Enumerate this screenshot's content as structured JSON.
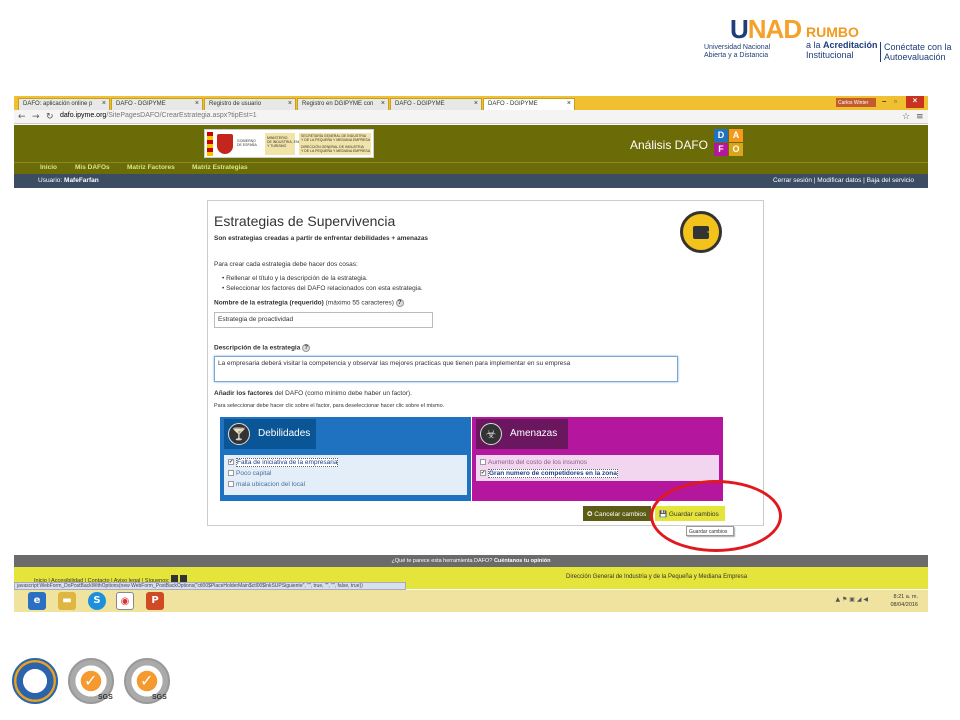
{
  "branding": {
    "unad_word": "NAD",
    "unad_u": "U",
    "unad_sub_1": "Universidad Nacional",
    "unad_sub_2": "Abierta y a Distancia",
    "rumbo": "RUMBO",
    "rumbo_sub_1": "a la ",
    "rumbo_sub_bold": "Acreditación",
    "rumbo_sub_2": "Institucional",
    "conectate_1": "Conéctate con la",
    "conectate_2": "Autoevaluación"
  },
  "browser": {
    "tabs": [
      {
        "label": "DAFO: aplicación online p"
      },
      {
        "label": "DAFO - DGIPYME"
      },
      {
        "label": "Registro de usuario"
      },
      {
        "label": "Registro en DGIPYME con"
      },
      {
        "label": "DAFO - DGIPYME"
      },
      {
        "label": "DAFO - DGIPYME"
      }
    ],
    "user_badge": "Carlos Winter",
    "url_host": "dafo.ipyme.org",
    "url_path": "/SitePagesDAFO/CrearEstrategia.aspx?tipEst=1"
  },
  "site": {
    "gov_line1": "GOBIERNO",
    "gov_line2": "DE ESPAÑA",
    "ministry_1": "MINISTERIO",
    "ministry_2": "DE INDUSTRIA, ENERGÍA",
    "ministry_3": "Y TURISMO",
    "secretaria_1": "SECRETARÍA GENERAL DE INDUSTRIA",
    "secretaria_2": "Y DE LA PEQUEÑA Y MEDIANA EMPRESA",
    "direccion_1": "DIRECCIÓN GENERAL DE INDUSTRIA",
    "direccion_2": "Y DE LA PEQUEÑA Y MEDIANA EMPRESA",
    "title": "Análisis DAFO",
    "dafo_letters": [
      "D",
      "A",
      "F",
      "O"
    ],
    "dafo_colors": [
      "#1f72c0",
      "#f39a1e",
      "#b5169e",
      "#d9a51a"
    ],
    "menu": [
      "Inicio",
      "Mis DAFOs",
      "Matriz Factores",
      "Matriz Estrategias"
    ],
    "user_label": "Usuario:",
    "user_name": "MafeFarfan",
    "user_links": "Cerrar sesión | Modificar datos | Baja del servicio"
  },
  "form": {
    "title": "Estrategias de Supervivencia",
    "subtitle": "Son estrategias creadas a partir de enfrentar debilidades + amenazas",
    "intro": "Para crear cada estrategia debe hacer dos cosas:",
    "bullets": [
      "Rellenar el título y la descripción de la estrategia.",
      "Seleccionar los factores del DAFO relacionados con esta estrategia."
    ],
    "name_label_bold": "Nombre de la estrategia (requerido)",
    "name_label_rest": " (máximo 55 caracteres)",
    "name_value": "Estrategia de proactividad",
    "desc_label": "Descripción de la estrategia",
    "desc_value": "La empresaria deberá visitar la competencia y observar las mejores practicas que tienen para implementar en su empresa",
    "factors_bold": "Añadir los factores",
    "factors_rest": " del DAFO (como mínimo debe haber un factor).",
    "factors_help": "Para seleccionar debe hacer clic sobre el factor, para deseleccionar hacer clic sobre el mismo.",
    "help_glyph": "?",
    "debilidades": {
      "title": "Debilidades",
      "items": [
        {
          "label": "Falta de iniciativa de la empresaria",
          "checked": true
        },
        {
          "label": "Poco capital",
          "checked": false
        },
        {
          "label": "mala ubicacion del local",
          "checked": false
        }
      ]
    },
    "amenazas": {
      "title": "Amenazas",
      "items": [
        {
          "label": "Aumento del costo de los insumos",
          "checked": false
        },
        {
          "label": "Gran numero de competidores en la zona",
          "checked": true
        }
      ]
    },
    "cancel_label": "Cancelar cambios",
    "save_label": "Guardar cambios",
    "tooltip": "Guardar cambios"
  },
  "footer": {
    "question": "¿Qué te parece esta herramienta DAFO? ",
    "question_bold": "Cuéntanos tu opinión",
    "links": "Inicio | Accesibilidad | Contacto | Aviso legal | Síguenos:",
    "dg": "Dirección General de Industria y de la Pequeña y Mediana Empresa",
    "status_url": "javascript:WebForm_DoPostBackWithOptions(new WebForm_PostBackOptions(\"ctl00$PlaceHolderMain$ctl00$lnkSUPSiguiente\", \"\", true, \"\", \"\", false, true))"
  },
  "taskbar": {
    "time": "8:21 a. m.",
    "date": "08/04/2016"
  },
  "seals": {
    "sgs": "SGS"
  }
}
